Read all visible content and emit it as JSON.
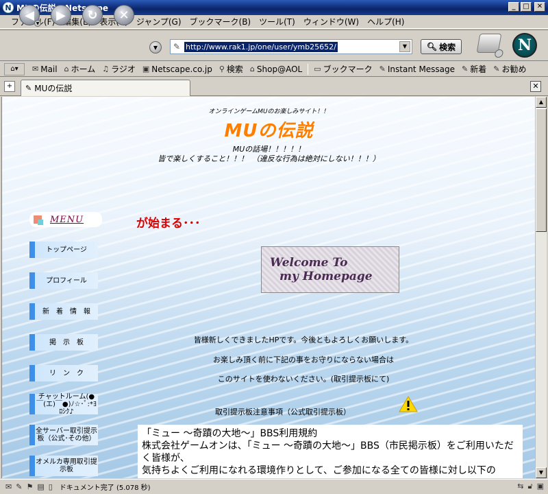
{
  "window": {
    "title": "MUの伝説 - Netscape",
    "app_icon": "N"
  },
  "menu": [
    "ファイル(F)",
    "編集(E)",
    "表示(V)",
    "ジャンプ(G)",
    "ブックマーク(B)",
    "ツール(T)",
    "ウィンドウ(W)",
    "ヘルプ(H)"
  ],
  "nav": {
    "url": "http://www.rak1.jp/one/user/ymb25652/",
    "search_label": "検索"
  },
  "personal_toolbar": [
    {
      "label": "Mail",
      "icon": "mail-icon"
    },
    {
      "label": "ホーム",
      "icon": "home-icon"
    },
    {
      "label": "ラジオ",
      "icon": "headphones-icon"
    },
    {
      "label": "Netscape.co.jp",
      "icon": "my-icon"
    },
    {
      "label": "検索",
      "icon": "search-icon"
    },
    {
      "label": "Shop@AOL",
      "icon": "shop-icon"
    },
    {
      "label": "ブックマーク",
      "icon": "folder-icon"
    },
    {
      "label": "Instant Message",
      "icon": "bookmark-icon"
    },
    {
      "label": "新着",
      "icon": "bookmark-icon"
    },
    {
      "label": "お勧め",
      "icon": "bookmark-icon"
    }
  ],
  "tab": {
    "title": "MUの伝説"
  },
  "page": {
    "tagline": "オンラインゲームMUのお楽しみサイト！！",
    "title": "MUの伝説",
    "line1": "MUの話場！！！！！",
    "line2": "皆で楽しくすること！！！　（違反な行為は絶対にしない！！！）",
    "menu_header": "MENU",
    "marquee": "が始まる･･･",
    "sidebar": [
      "トップページ",
      "プロフィール",
      "新　着　情　報",
      "掲　示　板",
      "リ　ン　ク",
      "チャットルーム(●￣(エ)￣●)ﾉ☆･ﾟ:*ﾖﾛｼｸ♪",
      "全サーバー取引提示板（公式･その他）",
      "オメルカ専用取引提示板"
    ],
    "welcome_line1": "Welcome To",
    "welcome_line2": "my Homepage",
    "notice1": "皆様新しくできましたHPです。今後ともよろしくお願いします。",
    "notice2": "お楽しみ頂く前に下記の事をお守りにならない場合は",
    "notice3": "このサイトを使わないください。(取引提示板にて)",
    "notice4": "取引提示板注意事項（公式取引提示板）",
    "terms_lines": [
      "「ミュー ～奇蹟の大地～」BBS利用規約",
      "株式会社ゲームオンは、「ミュー ～奇蹟の大地～」BBS（市民掲示板）をご利用いただく皆様が、",
      "気持ちよくご利用になれる環境作りとして、ご参加になる全ての皆様に対し以下の"
    ]
  },
  "status": {
    "text": "ドキュメント完了 (5.078 秒)"
  }
}
